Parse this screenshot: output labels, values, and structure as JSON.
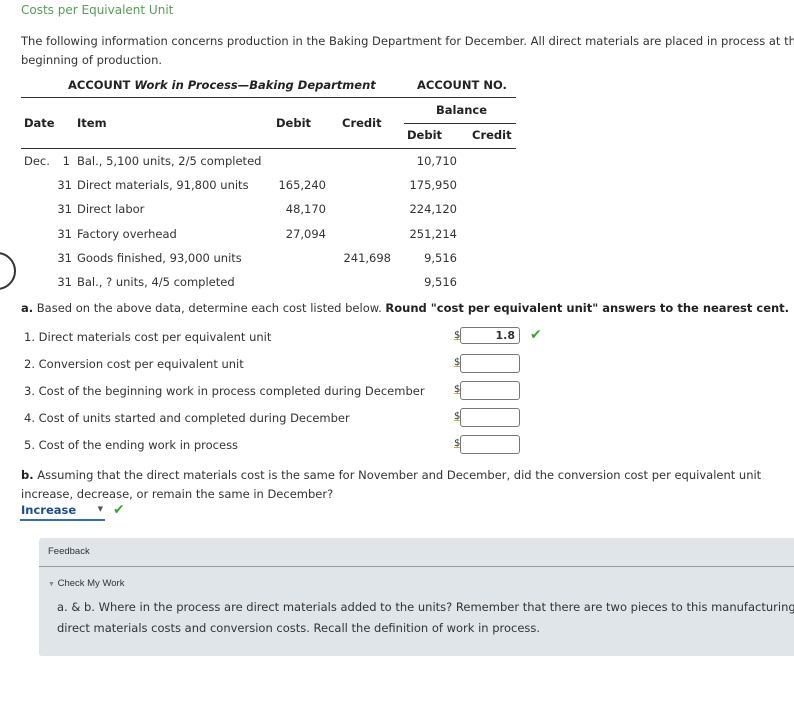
{
  "page": {
    "title": "Costs per Equivalent Unit",
    "intro": "The following information concerns production in the Baking Department for December. All direct materials are placed in process at the beginning of production."
  },
  "account": {
    "label": "ACCOUNT",
    "name": "Work in Process—Baking Department",
    "number_label": "ACCOUNT NO.",
    "columns": {
      "date": "Date",
      "item": "Item",
      "debit": "Debit",
      "credit": "Credit",
      "balance": "Balance",
      "balance_debit": "Debit",
      "balance_credit": "Credit"
    },
    "rows": [
      {
        "month": "Dec.",
        "day": "1",
        "item": "Bal., 5,100 units, 2/5 completed",
        "debit": "",
        "credit": "",
        "bal_debit": "10,710",
        "bal_credit": ""
      },
      {
        "month": "",
        "day": "31",
        "item": "Direct materials, 91,800 units",
        "debit": "165,240",
        "credit": "",
        "bal_debit": "175,950",
        "bal_credit": ""
      },
      {
        "month": "",
        "day": "31",
        "item": "Direct labor",
        "debit": "48,170",
        "credit": "",
        "bal_debit": "224,120",
        "bal_credit": ""
      },
      {
        "month": "",
        "day": "31",
        "item": "Factory overhead",
        "debit": "27,094",
        "credit": "",
        "bal_debit": "251,214",
        "bal_credit": ""
      },
      {
        "month": "",
        "day": "31",
        "item": "Goods finished, 93,000 units",
        "debit": "",
        "credit": "241,698",
        "bal_debit": "9,516",
        "bal_credit": ""
      },
      {
        "month": "",
        "day": "31",
        "item": "Bal., ? units, 4/5 completed",
        "debit": "",
        "credit": "",
        "bal_debit": "9,516",
        "bal_credit": ""
      }
    ]
  },
  "part_a": {
    "label": "a.",
    "instruction": "Based on the above data, determine each cost listed below.",
    "instruction_bold": "Round \"cost per equivalent unit\" answers to the nearest cent.",
    "currency_symbol": "$",
    "items": [
      {
        "number": "1.",
        "label": "Direct materials cost per equivalent unit",
        "value": "1.8",
        "status": "correct"
      },
      {
        "number": "2.",
        "label": "Conversion cost per equivalent unit",
        "value": "",
        "status": ""
      },
      {
        "number": "3.",
        "label": "Cost of the beginning work in process completed during December",
        "value": "",
        "status": ""
      },
      {
        "number": "4.",
        "label": "Cost of units started and completed during December",
        "value": "",
        "status": ""
      },
      {
        "number": "5.",
        "label": "Cost of the ending work in process",
        "value": "",
        "status": ""
      }
    ],
    "check_glyph": "✔"
  },
  "part_b": {
    "label": "b.",
    "question": "Assuming that the direct materials cost is the same for November and December, did the conversion cost per equivalent unit increase, decrease, or remain the same in December?",
    "selected": "Increase",
    "status": "correct",
    "check_glyph": "✔"
  },
  "feedback": {
    "title": "Feedback",
    "toggle_label": "Check My Work",
    "toggle_glyph": "▼",
    "line1": "a. & b. Where in the process are direct materials added to the units? Remember that there are two pieces to this manufacturing process:",
    "line2": "direct materials costs and conversion costs. Recall the definition of work in process."
  },
  "colors": {
    "title_green": "#5a9a5a",
    "check_green": "#3aa63a",
    "select_blue": "#1f4e8c",
    "feedback_bg": "#dfe5e9"
  }
}
